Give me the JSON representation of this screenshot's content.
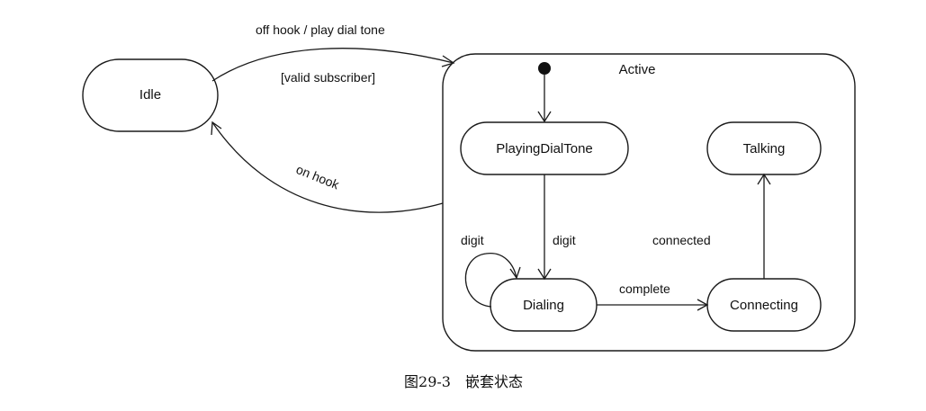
{
  "states": {
    "idle": "Idle",
    "active": "Active",
    "playing_dial_tone": "PlayingDialTone",
    "talking": "Talking",
    "dialing": "Dialing",
    "connecting": "Connecting"
  },
  "transitions": {
    "off_hook": "off hook / play dial tone",
    "valid_subscriber_guard": "[valid subscriber]",
    "on_hook": "on hook",
    "digit_self": "digit",
    "digit": "digit",
    "connected": "connected",
    "complete": "complete"
  },
  "caption": "图29-3　嵌套状态"
}
